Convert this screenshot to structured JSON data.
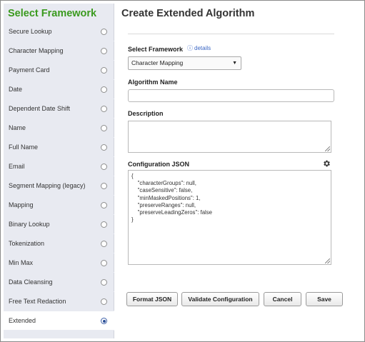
{
  "sidebar": {
    "title": "Select Framework",
    "items": [
      {
        "label": "Secure Lookup",
        "selected": false
      },
      {
        "label": "Character Mapping",
        "selected": false
      },
      {
        "label": "Payment Card",
        "selected": false
      },
      {
        "label": "Date",
        "selected": false
      },
      {
        "label": "Dependent Date Shift",
        "selected": false
      },
      {
        "label": "Name",
        "selected": false
      },
      {
        "label": "Full Name",
        "selected": false
      },
      {
        "label": "Email",
        "selected": false
      },
      {
        "label": "Segment Mapping (legacy)",
        "selected": false
      },
      {
        "label": "Mapping",
        "selected": false
      },
      {
        "label": "Binary Lookup",
        "selected": false
      },
      {
        "label": "Tokenization",
        "selected": false
      },
      {
        "label": "Min Max",
        "selected": false
      },
      {
        "label": "Data Cleansing",
        "selected": false
      },
      {
        "label": "Free Text Redaction",
        "selected": false
      },
      {
        "label": "Extended",
        "selected": true
      }
    ]
  },
  "main": {
    "title": "Create Extended Algorithm",
    "framework_label": "Select Framework",
    "details_icon": "info-icon",
    "details_link": "details",
    "framework_value": "Character Mapping",
    "algorithm_name_label": "Algorithm Name",
    "algorithm_name_value": "",
    "description_label": "Description",
    "description_value": "",
    "config_label": "Configuration JSON",
    "config_icon": "gear-icon",
    "config_value": "{\n    \"characterGroups\": null,\n    \"caseSensitive\": false,\n    \"minMaskedPositions\": 1,\n    \"preserveRanges\": null,\n    \"preserveLeadingZeros\": false\n}"
  },
  "buttons": {
    "format_json": "Format JSON",
    "validate": "Validate Configuration",
    "cancel": "Cancel",
    "save": "Save"
  },
  "colors": {
    "sidebar_title": "#3a9a1e",
    "sidebar_bg": "#e8eaf1",
    "link": "#3a66c4",
    "radio_selected": "#2b4f96"
  }
}
